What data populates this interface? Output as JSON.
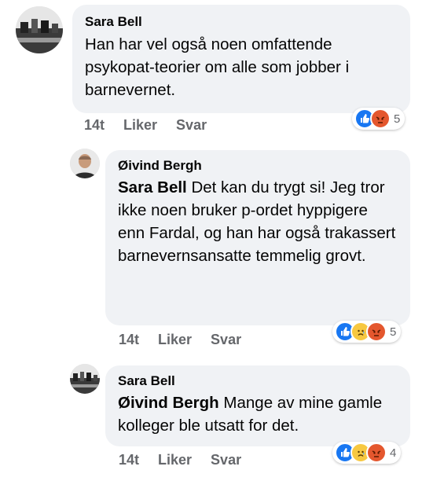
{
  "comments": [
    {
      "author": "Sara Bell",
      "mention": "",
      "text": "Han har vel også noen omfattende psykopat-teorier om alle som jobber i barnevernet.",
      "time": "14t",
      "like_label": "Liker",
      "reply_label": "Svar",
      "reactions": [
        "like-icon",
        "angry-icon"
      ],
      "reaction_count": "5"
    },
    {
      "author": "Øivind Bergh",
      "mention": "Sara Bell",
      "text": "Det kan du trygt si! Jeg tror ikke noen bruker p-ordet hyppigere enn Fardal, og han har også trakassert barnevernsansatte temmelig grovt.",
      "time": "14t",
      "like_label": "Liker",
      "reply_label": "Svar",
      "reactions": [
        "like-icon",
        "sad-icon",
        "angry-icon"
      ],
      "reaction_count": "5"
    },
    {
      "author": "Sara Bell",
      "mention": "Øivind Bergh",
      "text": "Mange av mine gamle kolleger ble utsatt for det.",
      "time": "14t",
      "like_label": "Liker",
      "reply_label": "Svar",
      "reactions": [
        "like-icon",
        "sad-icon",
        "angry-icon"
      ],
      "reaction_count": "4"
    }
  ],
  "colors": {
    "bubble": "#f0f2f5",
    "meta_text": "#65676b",
    "like": "#1877f2",
    "angry": "#e4572e",
    "sad": "#f7c841"
  }
}
